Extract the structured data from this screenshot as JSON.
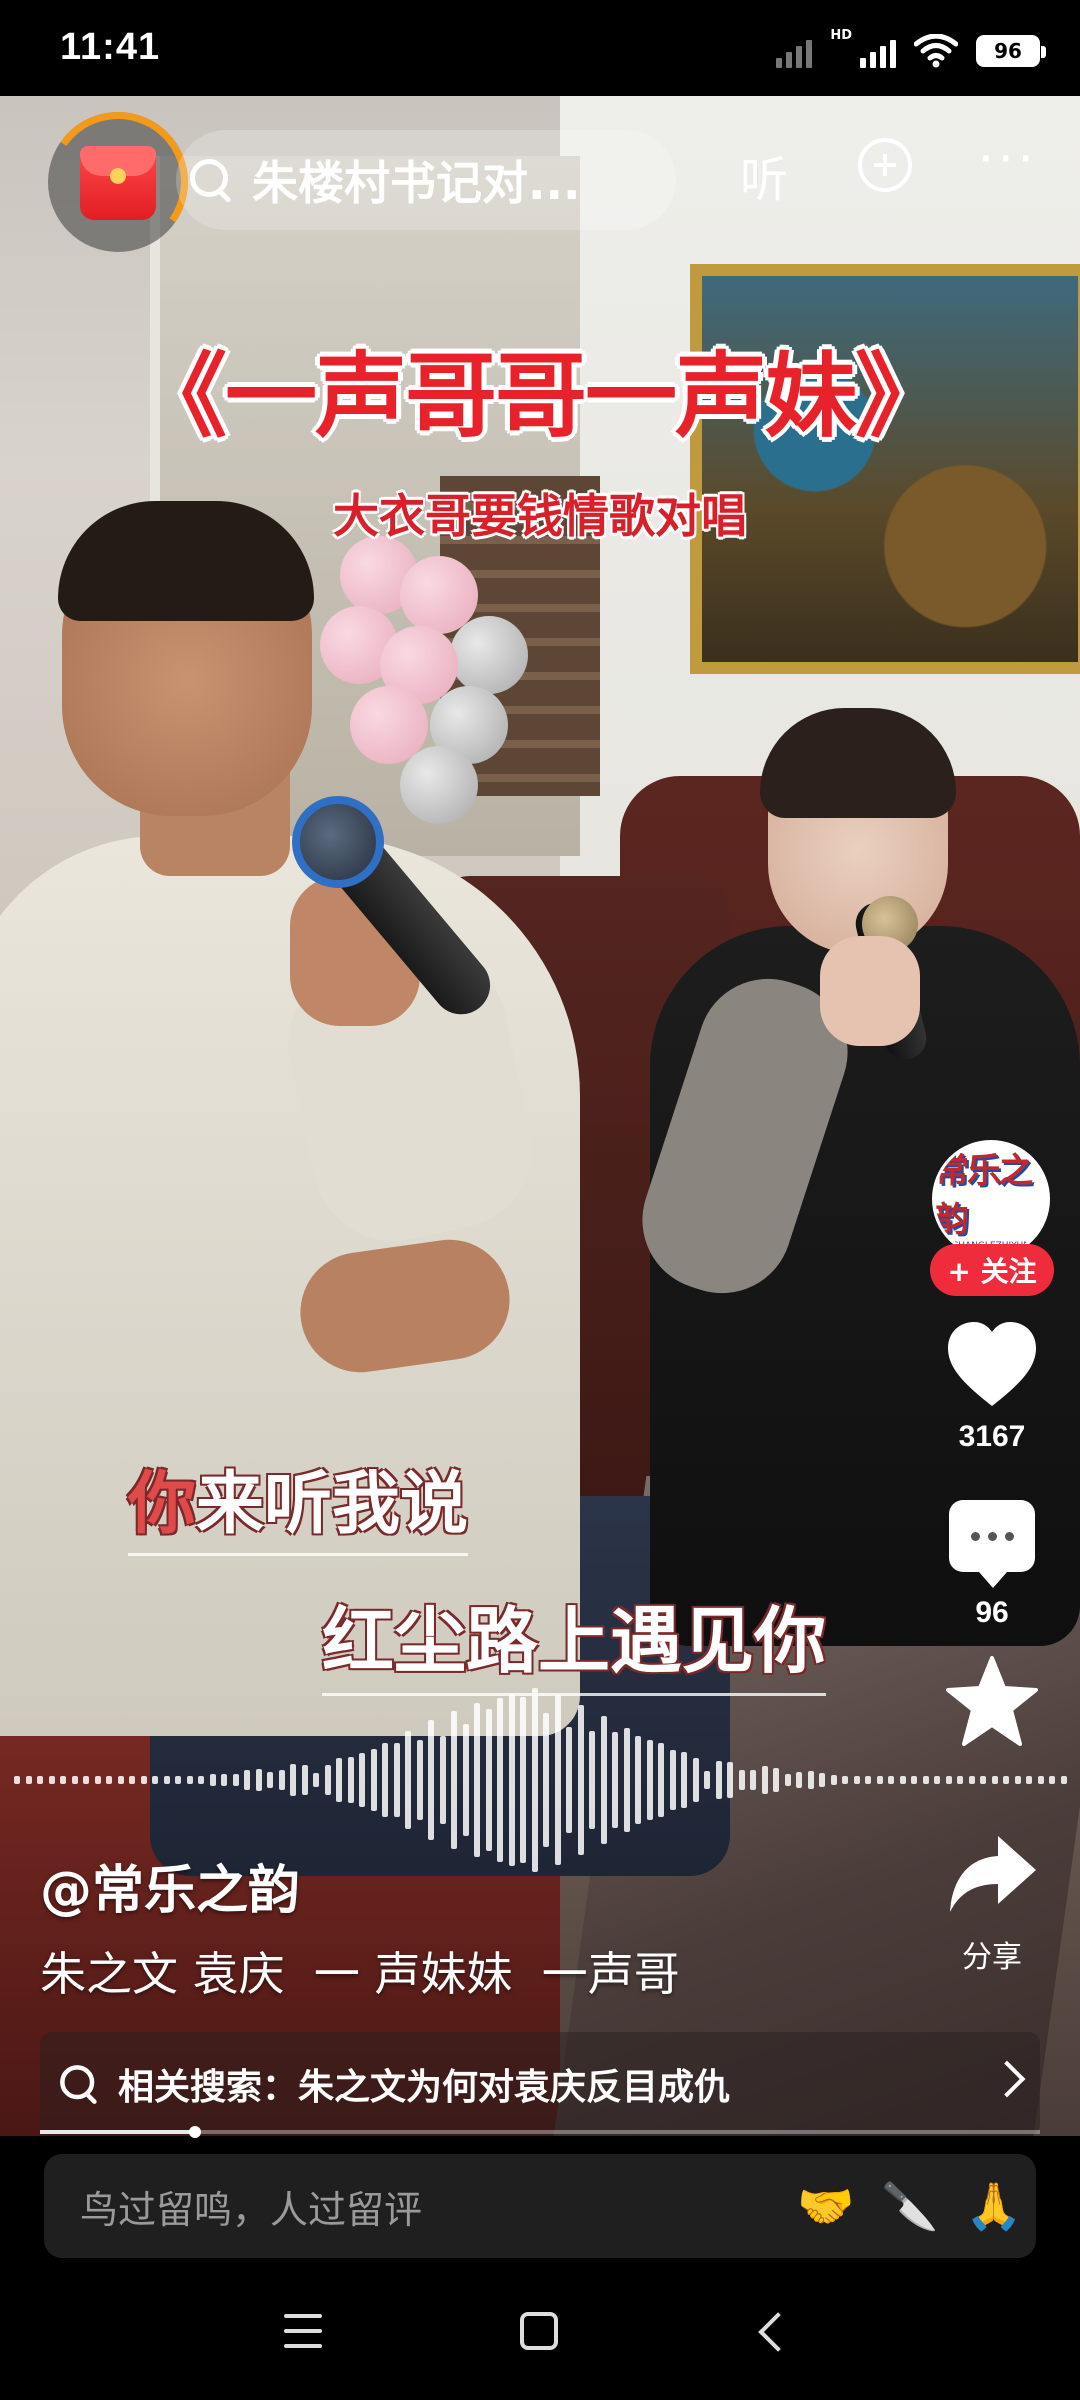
{
  "status_bar": {
    "time": "11:41",
    "network_label": "HD",
    "battery": "96"
  },
  "top_bar": {
    "search_text": "朱楼村书记对...",
    "listen_label": "听",
    "more_label": "···"
  },
  "video": {
    "title": "《一声哥哥一声妹》",
    "subtitle": "大衣哥要钱情歌对唱",
    "lyric_line_1_highlight": "你",
    "lyric_line_1_rest": "来听我说",
    "lyric_line_2": "红尘路上遇见你"
  },
  "creator": {
    "avatar_text": "常乐之韵",
    "avatar_subtext": "CHANGLEZHIYUN",
    "follow_label": "+ 关注"
  },
  "rail": {
    "likes": "3167",
    "comments": "96",
    "share_label": "分享"
  },
  "post": {
    "author": "@常乐之韵",
    "description": "朱之文 袁庆  一 声妹妹  一声哥"
  },
  "related": {
    "label": "相关搜索：",
    "query": "朱之文为何对袁庆反目成仇"
  },
  "playback": {
    "progress": 0.155
  },
  "comment_bar": {
    "placeholder": "鸟过留鸣，人过留评",
    "emojis": [
      "🤝",
      "🔪",
      "🙏"
    ]
  },
  "colors": {
    "accent_red": "#ee2c3c",
    "title_red": "#e8222a",
    "red_packet_ring": "#f39a1b"
  }
}
